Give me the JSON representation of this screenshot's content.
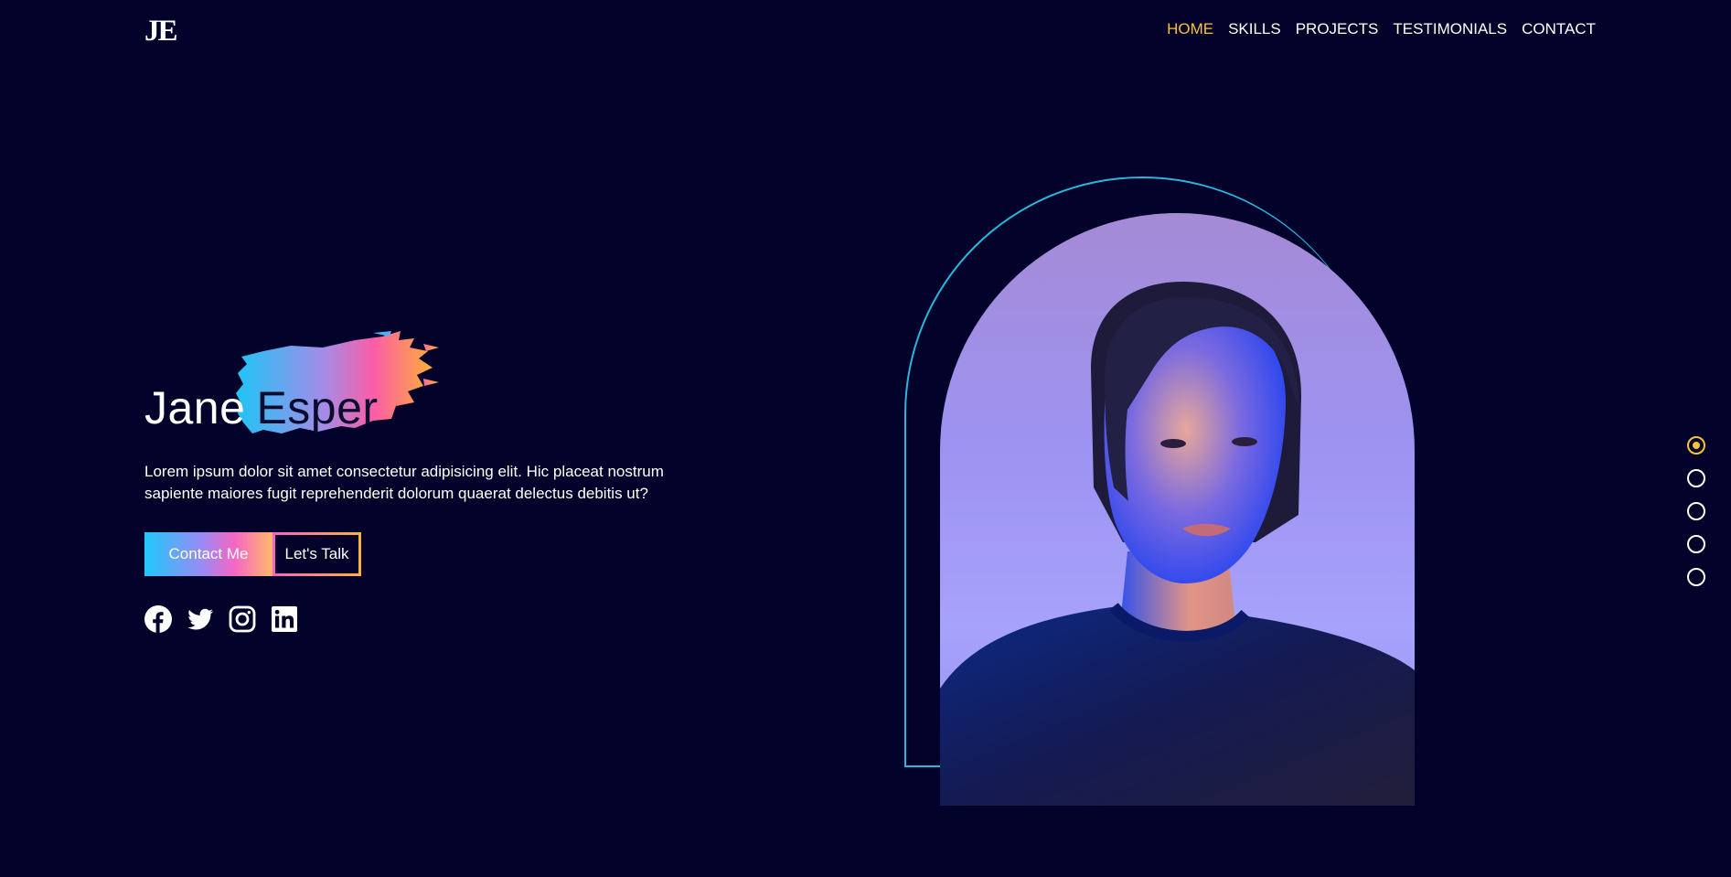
{
  "header": {
    "logo": "JE",
    "nav": [
      {
        "label": "HOME",
        "active": true
      },
      {
        "label": "SKILLS",
        "active": false
      },
      {
        "label": "PROJECTS",
        "active": false
      },
      {
        "label": "TESTIMONIALS",
        "active": false
      },
      {
        "label": "CONTACT",
        "active": false
      }
    ]
  },
  "hero": {
    "first_name": "Jane",
    "last_name": "Esper",
    "intro": "Lorem ipsum dolor sit amet consectetur adipisicing elit. Hic placeat nostrum sapiente maiores fugit reprehenderit dolorum quaerat delectus debitis ut?",
    "primary_button": "Contact Me",
    "secondary_button": "Let's Talk",
    "socials": [
      "facebook-icon",
      "twitter-icon",
      "instagram-icon",
      "linkedin-icon"
    ]
  },
  "section_dots": {
    "count": 5,
    "active_index": 0
  },
  "colors": {
    "background": "#02022a",
    "accent": "#f7c23b",
    "outline": "#2ab6de"
  }
}
